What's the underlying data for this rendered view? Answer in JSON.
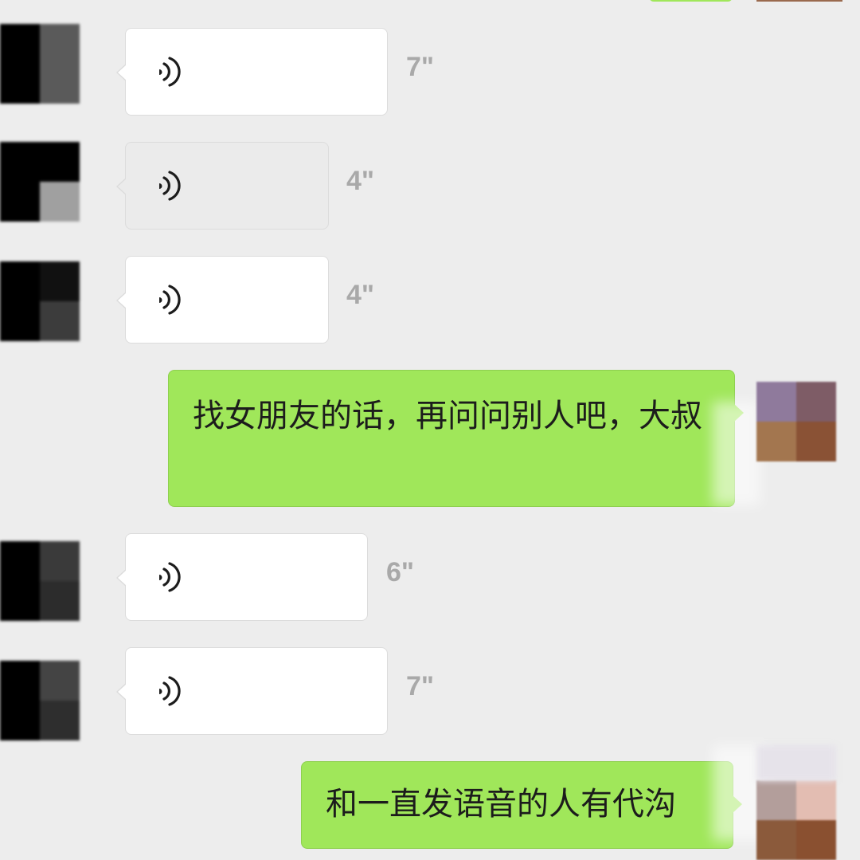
{
  "conversation": {
    "messages": [
      {
        "sender": "other",
        "type": "voice",
        "duration": "7\"",
        "state": "played"
      },
      {
        "sender": "other",
        "type": "voice",
        "duration": "4\"",
        "state": "playing"
      },
      {
        "sender": "other",
        "type": "voice",
        "duration": "4\"",
        "state": "played"
      },
      {
        "sender": "me",
        "type": "text",
        "text": "找女朋友的话，再问问别人吧，大叔"
      },
      {
        "sender": "other",
        "type": "voice",
        "duration": "6\"",
        "state": "played"
      },
      {
        "sender": "other",
        "type": "voice",
        "duration": "7\"",
        "state": "played"
      },
      {
        "sender": "me",
        "type": "text",
        "text": "和一直发语音的人有代沟"
      }
    ]
  },
  "icons": {
    "voice": "voice-wave-icon"
  },
  "colors": {
    "background": "#ededed",
    "incoming_bubble": "#ffffff",
    "incoming_bubble_playing": "#ebebeb",
    "outgoing_bubble": "#a0e75a",
    "duration_text": "#a9a9a9",
    "voice_icon": "#1c1c1c"
  }
}
